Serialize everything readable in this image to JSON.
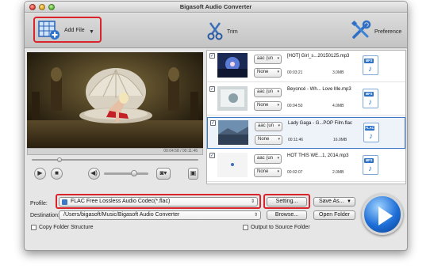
{
  "window": {
    "title": "Bigasoft Audio Converter"
  },
  "toolbar": {
    "add_file_label": "Add File",
    "trim_label": "Trim",
    "preference_label": "Preference",
    "add_file_icon": "add-file-icon",
    "trim_icon": "scissors-icon",
    "preference_icon": "wrench-screwdriver-icon"
  },
  "player": {
    "time": "00:04:58 / 00:11:46",
    "seek_position": 0.18,
    "volume": 0.65
  },
  "files": [
    {
      "name": "[HOT] Girl_s...20150125.mp3",
      "checked": true,
      "audio": "aac (un",
      "subtitle": "None",
      "duration": "00:03:21",
      "size": "3.0MB",
      "format": "MP3"
    },
    {
      "name": "Beyoncé - Wh... Love Me.mp3",
      "checked": true,
      "audio": "aac (un",
      "subtitle": "None",
      "duration": "00:04:50",
      "size": "4.0MB",
      "format": "MP3"
    },
    {
      "name": "Lady Gaga - G...POP Film.flac",
      "checked": true,
      "audio": "aac (un",
      "subtitle": "None",
      "duration": "00:11:46",
      "size": "16.0MB",
      "format": "FLAC"
    },
    {
      "name": "HOT THIS WE...1, 2014.mp3",
      "checked": true,
      "audio": "aac (un",
      "subtitle": "None",
      "duration": "00:02:07",
      "size": "2.0MB",
      "format": "MP3"
    }
  ],
  "bottom": {
    "profile_label": "Profile:",
    "profile_value": "FLAC Free Lossless Audio Codec(*.flac)",
    "setting_button": "Setting...",
    "save_as_button": "Save As...",
    "destination_label": "Destination:",
    "destination_value": "/Users/bigasoft/Music/Bigasoft Audio Converter",
    "browse_button": "Browse...",
    "open_folder_button": "Open Folder",
    "copy_folder_label": "Copy Folder Structure",
    "output_source_label": "Output to Source Folder"
  },
  "colors": {
    "highlight_red": "#d9242b",
    "accent_blue": "#2f73c9",
    "selection_border": "#3b79c4"
  }
}
